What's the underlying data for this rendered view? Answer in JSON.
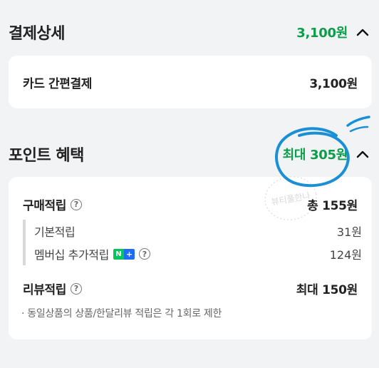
{
  "payment": {
    "title": "결제상세",
    "total": "3,100원",
    "method_label": "카드 간편결제",
    "method_amount": "3,100원"
  },
  "points": {
    "title": "포인트 혜택",
    "max_label": "최대 305원",
    "purchase_label": "구매적립",
    "purchase_total": "총 155원",
    "basic_label": "기본적립",
    "basic_amount": "31원",
    "membership_label": "멤버십 추가적립",
    "membership_amount": "124원",
    "membership_badge": "N+",
    "review_label": "리뷰적립",
    "review_total": "최대 150원",
    "note": "· 동일상품의 상품/한달리뷰 적립은 각 1회로 제한"
  },
  "watermark": "뷰티풀한나",
  "colors": {
    "accent": "#0a9d4a",
    "card": "#ffffff",
    "background": "#f2f3f5",
    "scribble": "#1a8fd6"
  },
  "icons": {
    "collapse": "chevron-up-icon",
    "help": "question-circle-icon",
    "npay": "naver-plus-badge-icon"
  }
}
